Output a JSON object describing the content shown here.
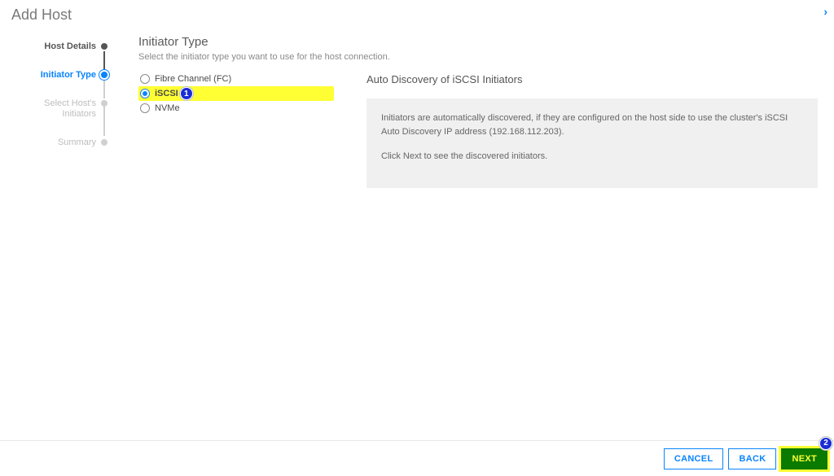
{
  "title": "Add Host",
  "stepper": {
    "steps": [
      {
        "label": "Host Details",
        "state": "done"
      },
      {
        "label": "Initiator Type",
        "state": "current"
      },
      {
        "label": "Select Host's Initiators",
        "state": "future"
      },
      {
        "label": "Summary",
        "state": "future"
      }
    ]
  },
  "main": {
    "section_title": "Initiator Type",
    "section_sub": "Select the initiator type you want to use for the host connection.",
    "options": {
      "fc": "Fibre Channel (FC)",
      "iscsi": "iSCSI",
      "nvme": "NVMe"
    },
    "info_title": "Auto Discovery of iSCSI Initiators",
    "info_p1": "Initiators are automatically discovered, if they are configured on the host side to use the cluster's iSCSI Auto Discovery IP address (192.168.112.203).",
    "info_p2": "Click Next to see the discovered initiators."
  },
  "footer": {
    "cancel": "CANCEL",
    "back": "BACK",
    "next": "NEXT"
  },
  "annotations": {
    "one": "1",
    "two": "2"
  }
}
